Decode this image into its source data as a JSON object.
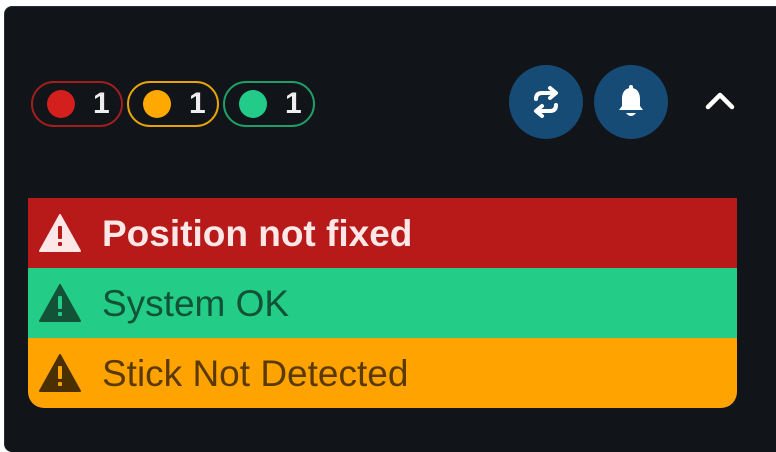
{
  "counters": [
    {
      "id": "error",
      "count": "1",
      "color": "#d3201d"
    },
    {
      "id": "warning",
      "count": "1",
      "color": "#ffa800"
    },
    {
      "id": "ok",
      "count": "1",
      "color": "#22cc88"
    }
  ],
  "toolbar": {
    "sync_icon": "sync-icon",
    "bell_icon": "bell-icon",
    "collapse_icon": "chevron-up-icon",
    "button_color": "#154b75"
  },
  "alerts": [
    {
      "level": "error",
      "text": "Position not fixed",
      "icon": "warning-triangle-icon",
      "bg": "#b81a1a"
    },
    {
      "level": "ok",
      "text": "System OK",
      "icon": "warning-triangle-icon",
      "bg": "#23cc87"
    },
    {
      "level": "warning",
      "text": "Stick Not Detected",
      "icon": "warning-triangle-icon",
      "bg": "#ffa300"
    }
  ]
}
